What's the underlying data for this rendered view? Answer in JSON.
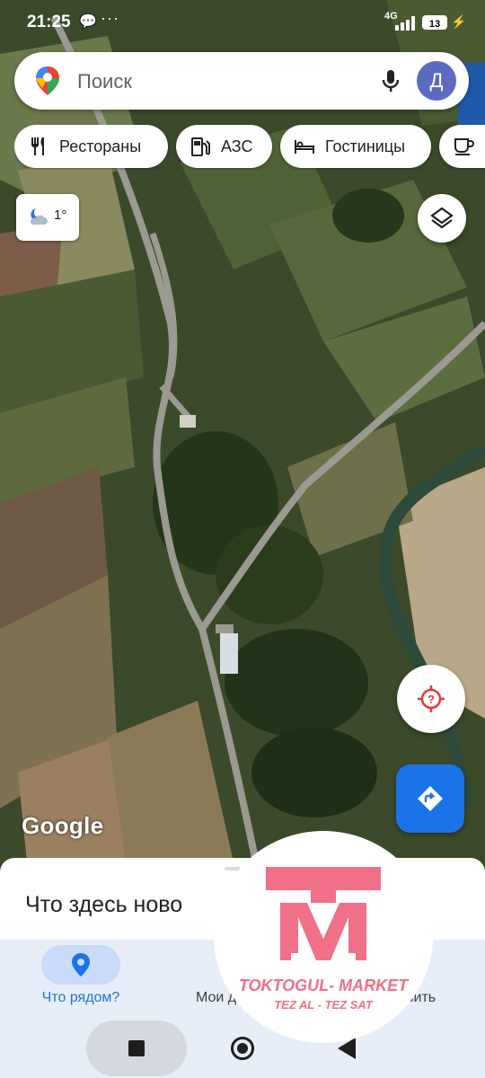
{
  "status_bar": {
    "time": "21:25",
    "network": "4G",
    "battery": "13"
  },
  "search": {
    "placeholder": "Поиск",
    "avatar_letter": "Д"
  },
  "chips": [
    {
      "label": "Рестораны",
      "icon": "restaurant-icon"
    },
    {
      "label": "АЗС",
      "icon": "gas-station-icon"
    },
    {
      "label": "Гостиницы",
      "icon": "hotel-icon"
    },
    {
      "label": "",
      "icon": "coffee-icon"
    }
  ],
  "weather": {
    "temp": "1°",
    "icon": "partly-cloudy-night-icon"
  },
  "map": {
    "attribution": "Google"
  },
  "sheet": {
    "title": "Что здесь ново"
  },
  "bottom_nav": {
    "items": [
      {
        "label": "Что рядом?",
        "active": true
      },
      {
        "label": "Мои д"
      },
      {
        "label": "вить"
      }
    ]
  },
  "watermark": {
    "name": "TOKTOGUL- MARKET",
    "tagline": "TEZ AL - TEZ SAT"
  },
  "colors": {
    "accent": "#1a73e8",
    "watermark": "#f07088",
    "avatar": "#5c6bc0"
  }
}
